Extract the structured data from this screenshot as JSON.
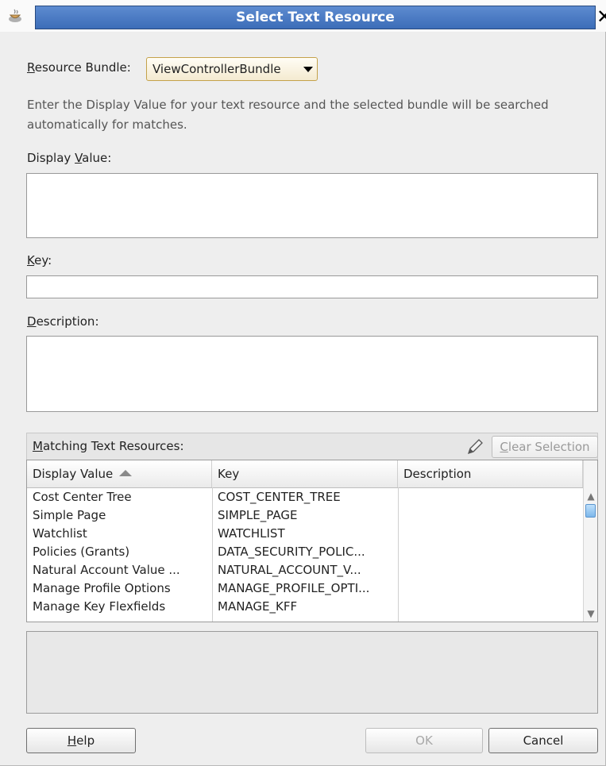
{
  "window": {
    "title": "Select Text Resource",
    "close_glyph": "✕"
  },
  "resource_bundle": {
    "label_mnemonic": "R",
    "label_rest": "esource Bundle:",
    "value": "ViewControllerBundle"
  },
  "hint": "Enter the Display Value for your text resource and the selected bundle will be searched automatically for matches.",
  "display_value": {
    "label_before": "Display ",
    "label_mnemonic": "V",
    "label_after": "alue:",
    "value": ""
  },
  "key": {
    "label_mnemonic": "K",
    "label_rest": "ey:",
    "value": ""
  },
  "description": {
    "label_mnemonic": "D",
    "label_rest": "escription:",
    "value": ""
  },
  "matching": {
    "title_mnemonic": "M",
    "title_rest": "atching Text Resources:",
    "clear_label_mnemonic": "C",
    "clear_label_rest": "lear Selection",
    "columns": [
      "Display Value",
      "Key",
      "Description"
    ],
    "rows": [
      {
        "display": "Cost Center Tree",
        "key": "COST_CENTER_TREE",
        "desc": ""
      },
      {
        "display": "Simple Page",
        "key": "SIMPLE_PAGE",
        "desc": ""
      },
      {
        "display": "Watchlist",
        "key": "WATCHLIST",
        "desc": ""
      },
      {
        "display": "Policies (Grants)",
        "key": "DATA_SECURITY_POLIC...",
        "desc": ""
      },
      {
        "display": "Natural Account Value ...",
        "key": "NATURAL_ACCOUNT_V...",
        "desc": ""
      },
      {
        "display": "Manage Profile Options",
        "key": "MANAGE_PROFILE_OPTI...",
        "desc": ""
      },
      {
        "display": "Manage Key Flexfields",
        "key": "MANAGE_KFF",
        "desc": ""
      }
    ]
  },
  "buttons": {
    "help_mnemonic": "H",
    "help_rest": "elp",
    "ok": "OK",
    "cancel": "Cancel"
  }
}
